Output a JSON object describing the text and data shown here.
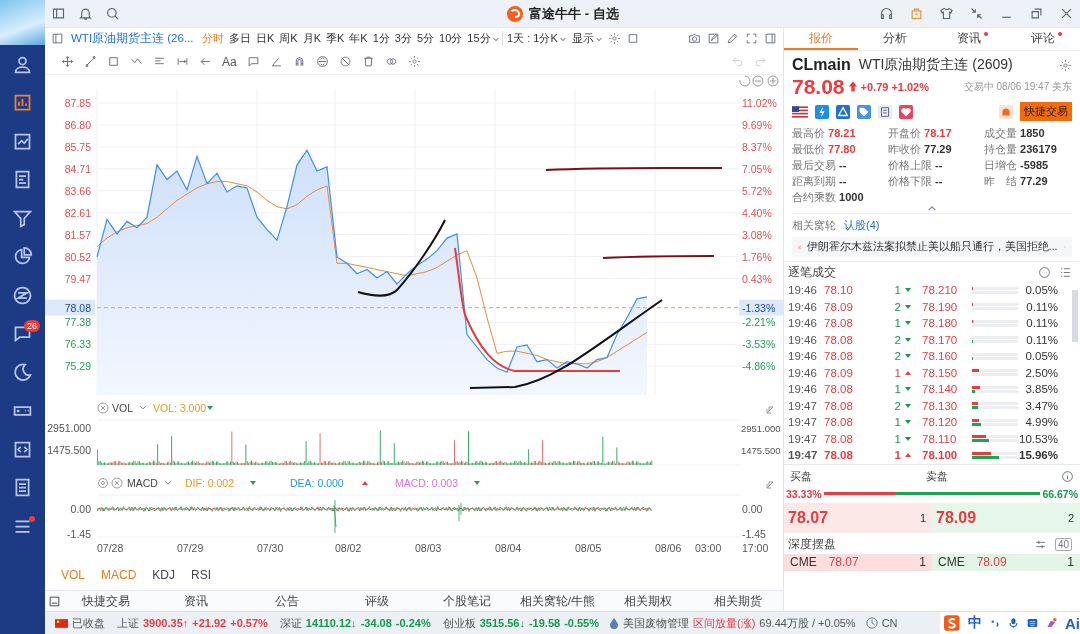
{
  "title_bar": {
    "title": "富途牛牛 - 自选"
  },
  "sidebar": {
    "items": [
      {
        "selected": false,
        "dot": false
      },
      {
        "selected": true,
        "dot": false
      },
      {
        "selected": false,
        "dot": false
      },
      {
        "selected": false,
        "dot": false
      },
      {
        "selected": false,
        "dot": false
      },
      {
        "selected": false,
        "dot": false
      },
      {
        "selected": false,
        "dot": false
      },
      {
        "selected": false,
        "dot": false,
        "badge": "26"
      },
      {
        "selected": false,
        "dot": false
      },
      {
        "selected": false,
        "dot": false
      },
      {
        "selected": false,
        "dot": false
      },
      {
        "selected": false,
        "dot": false
      },
      {
        "selected": false,
        "dot": true
      }
    ]
  },
  "chart_toolbar": {
    "symbol": "WTI原油期货主连 (26...",
    "periods": [
      {
        "label": "分时",
        "selected": true,
        "caret": false
      },
      {
        "label": "多日",
        "selected": false,
        "caret": false
      },
      {
        "label": "日K",
        "selected": false,
        "caret": false
      },
      {
        "label": "周K",
        "selected": false,
        "caret": false
      },
      {
        "label": "月K",
        "selected": false,
        "caret": false
      },
      {
        "label": "季K",
        "selected": false,
        "caret": false
      },
      {
        "label": "年K",
        "selected": false,
        "caret": false
      },
      {
        "label": "1分",
        "selected": false,
        "caret": false
      },
      {
        "label": "3分",
        "selected": false,
        "caret": false
      },
      {
        "label": "5分",
        "selected": false,
        "caret": false
      },
      {
        "label": "10分",
        "selected": false,
        "caret": false
      },
      {
        "label": "15分",
        "selected": false,
        "caret": true
      }
    ],
    "range": "1天 : 1分K",
    "display": "显示",
    "text_tool": "Aa"
  },
  "price_chart": {
    "chart_data": {
      "type": "area",
      "ylim": [
        73.91,
        88.52
      ],
      "grid": true,
      "ref_lines": [
        {
          "axis": "y",
          "value": 78.08
        }
      ],
      "yticks": [
        {
          "value": 87.85,
          "label": "87.85"
        },
        {
          "value": 86.8,
          "label": "86.80"
        },
        {
          "value": 85.75,
          "label": "85.75"
        },
        {
          "value": 84.71,
          "label": "84.71"
        },
        {
          "value": 83.66,
          "label": "83.66"
        },
        {
          "value": 82.61,
          "label": "82.61"
        },
        {
          "value": 81.57,
          "label": "81.57"
        },
        {
          "value": 80.52,
          "label": "80.52"
        },
        {
          "value": 79.47,
          "label": "79.47"
        },
        {
          "value": 77.38,
          "label": "77.38"
        },
        {
          "value": 76.33,
          "label": "76.33"
        },
        {
          "value": 75.29,
          "label": "75.29"
        }
      ],
      "series": [
        {
          "type": "area",
          "color": "#3d8ef0",
          "values": [
            80.5,
            82.3,
            81.6,
            82.2,
            81.9,
            82.4,
            84.9,
            84.2,
            84.6,
            83.7,
            85.3,
            84.0,
            84.5,
            83.6,
            83.9,
            83.8,
            82.4,
            81.8,
            81.3,
            82.9,
            84.9,
            85.6,
            84.6,
            84.8,
            80.5,
            80.2,
            79.7,
            79.9,
            79.5,
            79.8,
            79.2,
            79.7,
            80.1,
            80.4,
            80.8,
            81.4,
            81.6,
            76.8,
            76.2,
            75.6,
            75.2,
            75.0,
            76.2,
            76.3,
            75.5,
            75.6,
            75.2,
            75.5,
            75.4,
            75.2,
            75.6,
            75.7,
            76.8,
            77.6,
            78.5,
            78.6
          ]
        },
        {
          "type": "line",
          "color": "#f0893a",
          "values": [
            81.0,
            81.4,
            81.7,
            81.9,
            82.0,
            82.1,
            82.4,
            82.8,
            83.2,
            83.5,
            83.8,
            84.0,
            84.1,
            84.1,
            84.0,
            83.9,
            83.6,
            83.2,
            82.9,
            82.8,
            83.0,
            83.4,
            83.7,
            83.9,
            80.2,
            80.2,
            80.1,
            80.0,
            79.9,
            79.8,
            79.7,
            79.6,
            79.7,
            79.8,
            80.0,
            80.3,
            80.6,
            80.8,
            79.5,
            77.6,
            75.9,
            76.0,
            76.0,
            75.9,
            75.8,
            75.6,
            75.5,
            75.4,
            75.4,
            75.4,
            75.5,
            75.7,
            76.0,
            76.3,
            76.6,
            76.9
          ]
        }
      ]
    },
    "right_ticks": [
      {
        "label": "11.02%",
        "up": true
      },
      {
        "label": "9.69%",
        "up": true
      },
      {
        "label": "8.37%",
        "up": true
      },
      {
        "label": "7.05%",
        "up": true
      },
      {
        "label": "5.72%",
        "up": true
      },
      {
        "label": "4.40%",
        "up": true
      },
      {
        "label": "3.08%",
        "up": true
      },
      {
        "label": "1.76%",
        "up": true
      },
      {
        "label": "0.43%",
        "up": true
      },
      {
        "label": "-2.21%",
        "up": false
      },
      {
        "label": "-3.53%",
        "up": false
      },
      {
        "label": "-4.86%",
        "up": false
      }
    ],
    "current": {
      "price": "78.08",
      "pct": "-1.33%"
    }
  },
  "x_axis": [
    "07/28",
    "07/29",
    "07/30",
    "08/02",
    "08/03",
    "08/04",
    "08/05",
    "08/06",
    "03:00",
    "17:00"
  ],
  "volume": {
    "title": "VOL",
    "indicator": "VOL: 3.000",
    "up": false,
    "left_ticks": [
      "2951.000",
      "1475.500"
    ],
    "right_ticks": [
      "2951.000",
      "1475.500"
    ]
  },
  "macd": {
    "title": "MACD",
    "lines": [
      {
        "label": "DIF: ",
        "value": "0.002",
        "up": false,
        "color": "#f7931e"
      },
      {
        "label": "DEA: ",
        "value": "0.000",
        "up": true,
        "color": "#1e9be9"
      },
      {
        "label": "MACD: ",
        "value": "0.003",
        "up": false,
        "color": "#e36ee0"
      }
    ],
    "left_ticks": [
      "0.00",
      "-1.45"
    ],
    "right_ticks": [
      "0.00",
      "-1.45"
    ]
  },
  "indicator_tabs": [
    {
      "label": "VOL",
      "selected": true
    },
    {
      "label": "MACD",
      "selected": true
    },
    {
      "label": "KDJ",
      "selected": false
    },
    {
      "label": "RSI",
      "selected": false
    }
  ],
  "bottom_tabs": [
    "快捷交易",
    "资讯",
    "公告",
    "评级",
    "个股笔记",
    "相关窝轮/牛熊",
    "相关期权",
    "相关期货"
  ],
  "quote_tabs": [
    {
      "label": "报价",
      "selected": true,
      "dot": false
    },
    {
      "label": "分析",
      "selected": false,
      "dot": false
    },
    {
      "label": "资讯",
      "selected": false,
      "dot": true
    },
    {
      "label": "评论",
      "selected": false,
      "dot": true
    }
  ],
  "quote": {
    "code": "CLmain",
    "name": "WTI原油期货主连 (2609)",
    "price": "78.08",
    "up": true,
    "change": "+0.79",
    "pct": "+1.02%",
    "status": "交易中 08/06 19:47 美东",
    "trade_button": "快捷交易",
    "stats": [
      {
        "text": "最高价 **78.21**",
        "up": true
      },
      {
        "text": "开盘价 **78.17**",
        "up": true
      },
      {
        "text": "成交量 **1850**",
        "up": false
      },
      {
        "text": "最低价 **77.80**",
        "up": true
      },
      {
        "text": "昨收价 **77.29**",
        "up": false
      },
      {
        "text": "持仓量 **236179**",
        "up": false
      },
      {
        "text": "最后交易 **--**",
        "up": false
      },
      {
        "text": "价格上限 **--**",
        "up": false
      },
      {
        "text": "日增仓 **-5985**",
        "up": false
      },
      {
        "text": "距离到期 **--**",
        "up": false
      },
      {
        "text": "价格下限 **--**",
        "up": false
      },
      {
        "text": "昨　结 **77.29**",
        "up": false
      },
      {
        "text": "合约乘数 **1000**",
        "up": false
      }
    ],
    "warrants_label": "相关窝轮",
    "warrants_link": "认股(4)",
    "news": "伊朗霍尔木兹法案拟禁止美以船只通行，美国拒绝..."
  },
  "trades": {
    "title": "逐笔成交",
    "rows": [
      {
        "time": "19:46",
        "price": "78.10",
        "qty": "1",
        "up": false,
        "level_price": "78.210",
        "pct": "0.05%",
        "buy_bar": {
          "level": 0.03
        },
        "latest": false
      },
      {
        "time": "19:46",
        "price": "78.09",
        "qty": "2",
        "up": false,
        "level_price": "78.190",
        "pct": "0.11%",
        "buy_bar": {
          "level": 0.03
        },
        "latest": false
      },
      {
        "time": "19:46",
        "price": "78.08",
        "qty": "1",
        "up": false,
        "level_price": "78.180",
        "pct": "0.11%",
        "buy_bar": {
          "level": 0.03
        },
        "latest": false
      },
      {
        "time": "19:46",
        "price": "78.08",
        "qty": "2",
        "up": false,
        "level_price": "78.170",
        "pct": "0.11%",
        "sell_bar": {
          "level": 0.03
        },
        "latest": false
      },
      {
        "time": "19:46",
        "price": "78.08",
        "qty": "2",
        "up": false,
        "level_price": "78.160",
        "pct": "0.05%",
        "sell_bar": {
          "level": 0.03
        },
        "latest": false
      },
      {
        "time": "19:46",
        "price": "78.09",
        "qty": "1",
        "up": true,
        "level_price": "78.150",
        "pct": "2.50%",
        "buy_bar": {
          "level": 0.15
        },
        "latest": false
      },
      {
        "time": "19:46",
        "price": "78.08",
        "qty": "1",
        "up": false,
        "level_price": "78.140",
        "pct": "3.85%",
        "buy_bar": {
          "level": 0.17
        },
        "sell_bar": {
          "level": 0.07
        },
        "latest": false
      },
      {
        "time": "19:47",
        "price": "78.08",
        "qty": "2",
        "up": false,
        "level_price": "78.130",
        "pct": "3.47%",
        "buy_bar": {
          "level": 0.12
        },
        "sell_bar": {
          "level": 0.12
        },
        "latest": false
      },
      {
        "time": "19:47",
        "price": "78.08",
        "qty": "1",
        "up": false,
        "level_price": "78.120",
        "pct": "4.99%",
        "buy_bar": {
          "level": 0.15
        },
        "sell_bar": {
          "level": 0.2
        },
        "latest": false
      },
      {
        "time": "19:47",
        "price": "78.08",
        "qty": "1",
        "up": false,
        "level_price": "78.110",
        "pct": "10.53%",
        "buy_bar": {
          "level": 0.3
        },
        "sell_bar": {
          "level": 0.36
        },
        "latest": false
      },
      {
        "time": "19:47",
        "price": "78.08",
        "qty": "1",
        "up": true,
        "level_price": "78.100",
        "pct": "15.96%",
        "buy_bar": {
          "level": 0.41
        },
        "sell_bar": {
          "level": 0.59
        },
        "latest": true
      }
    ]
  },
  "order_book": {
    "buy_label": "买盘",
    "sell_label": "卖盘",
    "buy_pct": "33.33%",
    "sell_pct": "66.67%",
    "ratio": {
      "level": 0.3333
    },
    "bid": {
      "price": "78.07",
      "size": "1"
    },
    "ask": {
      "price": "78.09",
      "size": "2"
    }
  },
  "depth": {
    "title": "深度摆盘",
    "levels": "40",
    "rows": [
      {
        "bid_exchange": "CME",
        "bid_price": "78.07",
        "bid_size": "1",
        "ask_exchange": "CME",
        "ask_price": "78.09",
        "ask_size": "1"
      }
    ]
  },
  "status_bar": {
    "market_state": "已收盘",
    "indices": [
      {
        "name": "上证",
        "value": "3900.35↑",
        "change": "+21.92",
        "pct": "+0.57%",
        "up": true
      },
      {
        "name": "深证",
        "value": "14110.12↓",
        "change": "-34.08",
        "pct": "-0.24%",
        "up": false
      },
      {
        "name": "创业板",
        "value": "3515.56↓",
        "change": "-19.58",
        "pct": "-0.55%",
        "up": false
      }
    ],
    "ticker_name": "美国废物管理",
    "ticker_event": "区间放量(涨)",
    "ticker_detail": "69.44万股 / +0.05%",
    "region": "CN",
    "ime_mode": "中",
    "ime_ai": "Ai"
  }
}
